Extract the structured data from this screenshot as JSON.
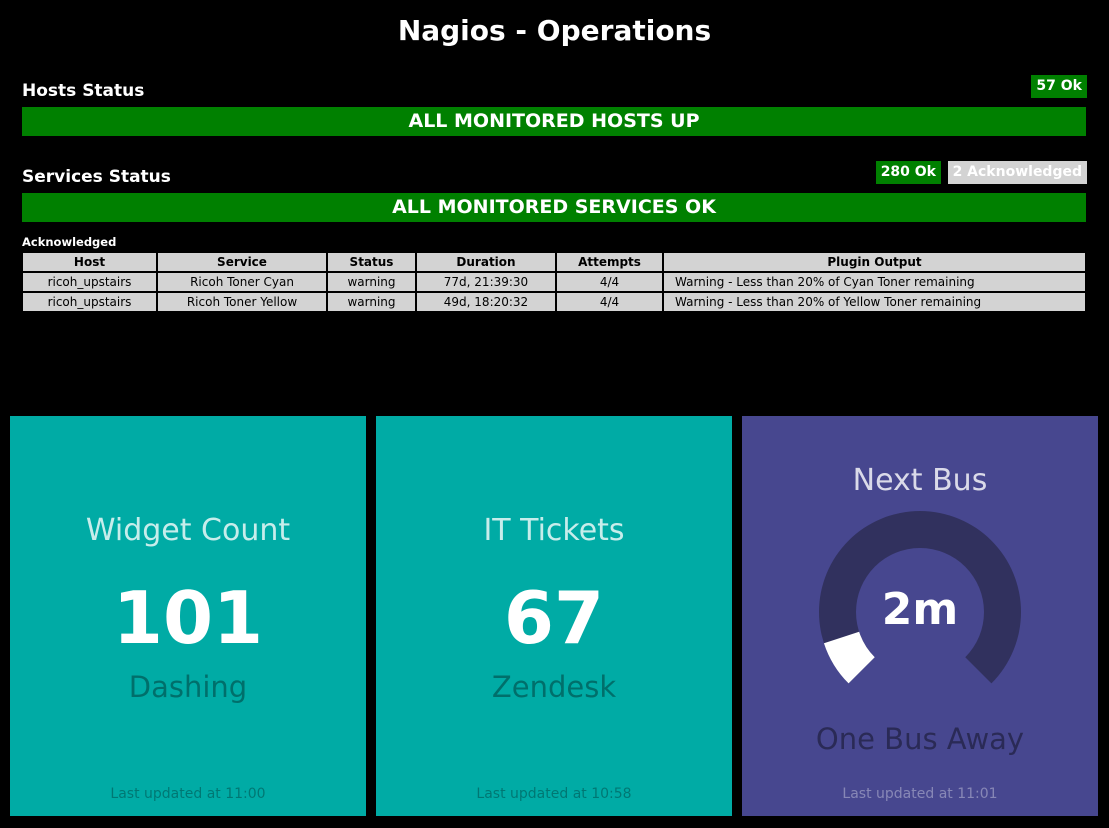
{
  "header": {
    "title": "Nagios - Operations"
  },
  "hosts": {
    "label": "Hosts Status",
    "ok_badge": "57 Ok",
    "banner": "ALL MONITORED HOSTS UP",
    "colors": {
      "ok": "#008000"
    }
  },
  "services": {
    "label": "Services Status",
    "ok_badge": "280 Ok",
    "ack_badge": "2 Acknowledged",
    "banner": "ALL MONITORED SERVICES OK",
    "colors": {
      "ok": "#008000",
      "acknowledged": "#d3d3d3"
    }
  },
  "acknowledged": {
    "label": "Acknowledged",
    "columns": [
      "Host",
      "Service",
      "Status",
      "Duration",
      "Attempts",
      "Plugin Output"
    ],
    "rows": [
      [
        "ricoh_upstairs",
        "Ricoh Toner Cyan",
        "warning",
        "77d, 21:39:30",
        "4/4",
        "Warning - Less than 20% of Cyan Toner remaining"
      ],
      [
        "ricoh_upstairs",
        "Ricoh Toner Yellow",
        "warning",
        "49d, 18:20:32",
        "4/4",
        "Warning - Less than 20% of Yellow Toner remaining"
      ]
    ]
  },
  "widgets": [
    {
      "title": "Widget Count",
      "value": "101",
      "moreinfo": "Dashing",
      "updated": "Last updated at 11:00",
      "color": "#00aba5"
    },
    {
      "title": "IT Tickets",
      "value": "67",
      "moreinfo": "Zendesk",
      "updated": "Last updated at 10:58",
      "color": "#00aba5"
    },
    {
      "title": "Next Bus",
      "value": "2m",
      "moreinfo": "One Bus Away",
      "updated": "Last updated at 11:01",
      "color": "#47478f",
      "meter_fraction": 0.1
    }
  ]
}
